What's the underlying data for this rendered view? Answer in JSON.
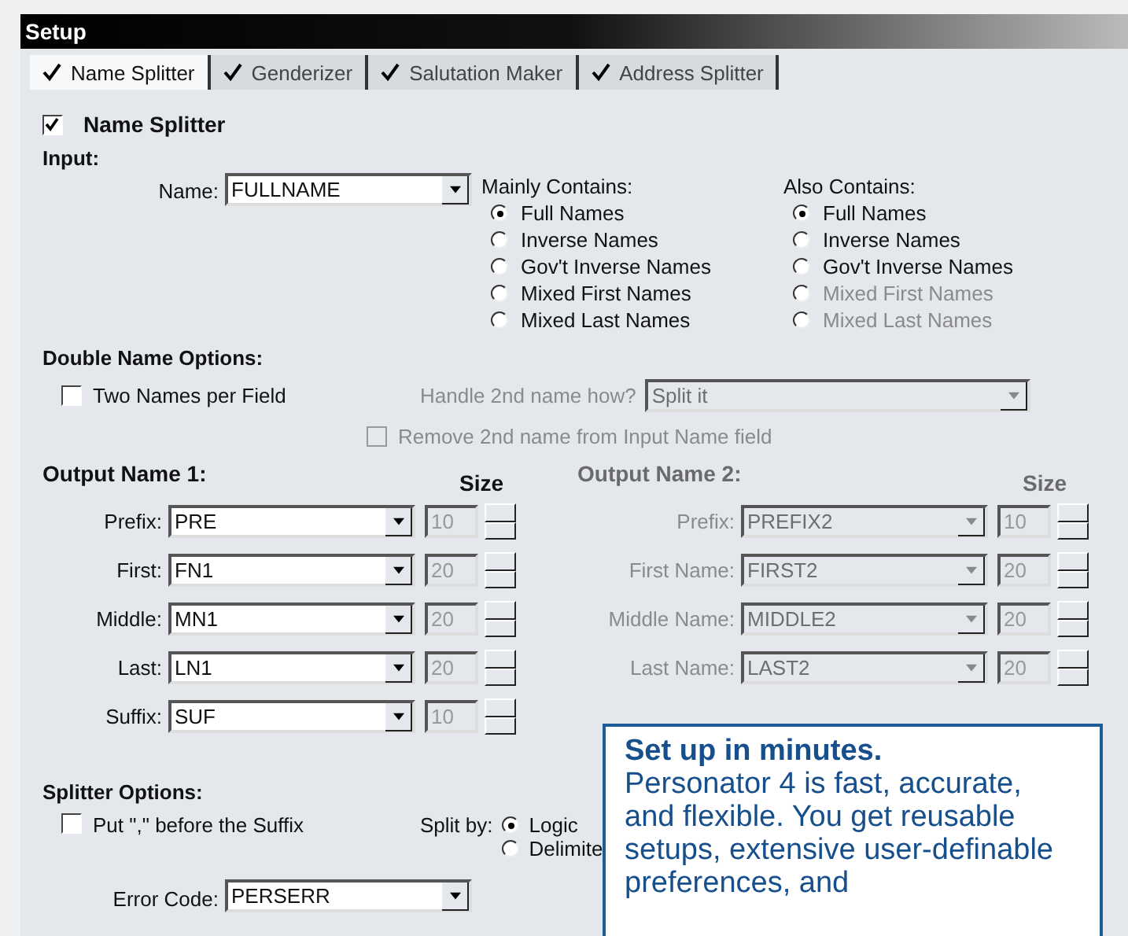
{
  "window": {
    "title": "Setup"
  },
  "tabs": [
    {
      "label": "Name Splitter",
      "checked": true,
      "selected": true
    },
    {
      "label": "Genderizer",
      "checked": true,
      "selected": false
    },
    {
      "label": "Salutation Maker",
      "checked": true,
      "selected": false
    },
    {
      "label": "Address Splitter",
      "checked": true,
      "selected": false
    }
  ],
  "name_splitter": {
    "label": "Name Splitter",
    "checked": true
  },
  "input": {
    "heading": "Input:",
    "name_label": "Name:",
    "name_value": "FULLNAME",
    "groups": [
      {
        "heading": "Mainly Contains:",
        "options": [
          {
            "label": "Full Names",
            "selected": true,
            "disabled": false
          },
          {
            "label": "Inverse Names",
            "selected": false,
            "disabled": false
          },
          {
            "label": "Gov't Inverse Names",
            "selected": false,
            "disabled": false
          },
          {
            "label": "Mixed First Names",
            "selected": false,
            "disabled": false
          },
          {
            "label": "Mixed Last Names",
            "selected": false,
            "disabled": false
          }
        ]
      },
      {
        "heading": "Also Contains:",
        "options": [
          {
            "label": "Full Names",
            "selected": true,
            "disabled": false
          },
          {
            "label": "Inverse Names",
            "selected": false,
            "disabled": false
          },
          {
            "label": "Gov't Inverse Names",
            "selected": false,
            "disabled": false
          },
          {
            "label": "Mixed First Names",
            "selected": false,
            "disabled": true
          },
          {
            "label": "Mixed Last Names",
            "selected": false,
            "disabled": true
          }
        ]
      }
    ]
  },
  "double_name": {
    "heading": "Double Name Options:",
    "two_names": {
      "label": "Two Names per Field",
      "checked": false
    },
    "handle_label": "Handle 2nd name how?",
    "handle_value": "Split it",
    "disabled": true,
    "remove": {
      "label": "Remove 2nd name from Input Name field",
      "checked": false
    }
  },
  "outputs": [
    {
      "heading": "Output Name 1:",
      "size_heading": "Size",
      "disabled": false,
      "rows": [
        {
          "label": "Prefix:",
          "value": "PRE",
          "size": "10"
        },
        {
          "label": "First:",
          "value": "FN1",
          "size": "20"
        },
        {
          "label": "Middle:",
          "value": "MN1",
          "size": "20"
        },
        {
          "label": "Last:",
          "value": "LN1",
          "size": "20"
        },
        {
          "label": "Suffix:",
          "value": "SUF",
          "size": "10"
        }
      ]
    },
    {
      "heading": "Output Name 2:",
      "size_heading": "Size",
      "disabled": true,
      "rows": [
        {
          "label": "Prefix:",
          "value": "PREFIX2",
          "size": "10"
        },
        {
          "label": "First Name:",
          "value": "FIRST2",
          "size": "20"
        },
        {
          "label": "Middle Name:",
          "value": "MIDDLE2",
          "size": "20"
        },
        {
          "label": "Last Name:",
          "value": "LAST2",
          "size": "20"
        }
      ]
    }
  ],
  "splitter_options": {
    "heading": "Splitter Options:",
    "comma": {
      "label": "Put \",\" before the Suffix",
      "checked": false
    },
    "split_label": "Split by:",
    "split_options": [
      {
        "label": "Logic",
        "selected": true
      },
      {
        "label": "Delimite",
        "selected": false
      }
    ],
    "error_label": "Error Code:",
    "error_value": "PERSERR"
  },
  "callout": {
    "title": "Set up in minutes.",
    "body": "Personator 4 is fast, accurate, and flexible. You get reusable setups, extensive user-definable preferences, and"
  }
}
